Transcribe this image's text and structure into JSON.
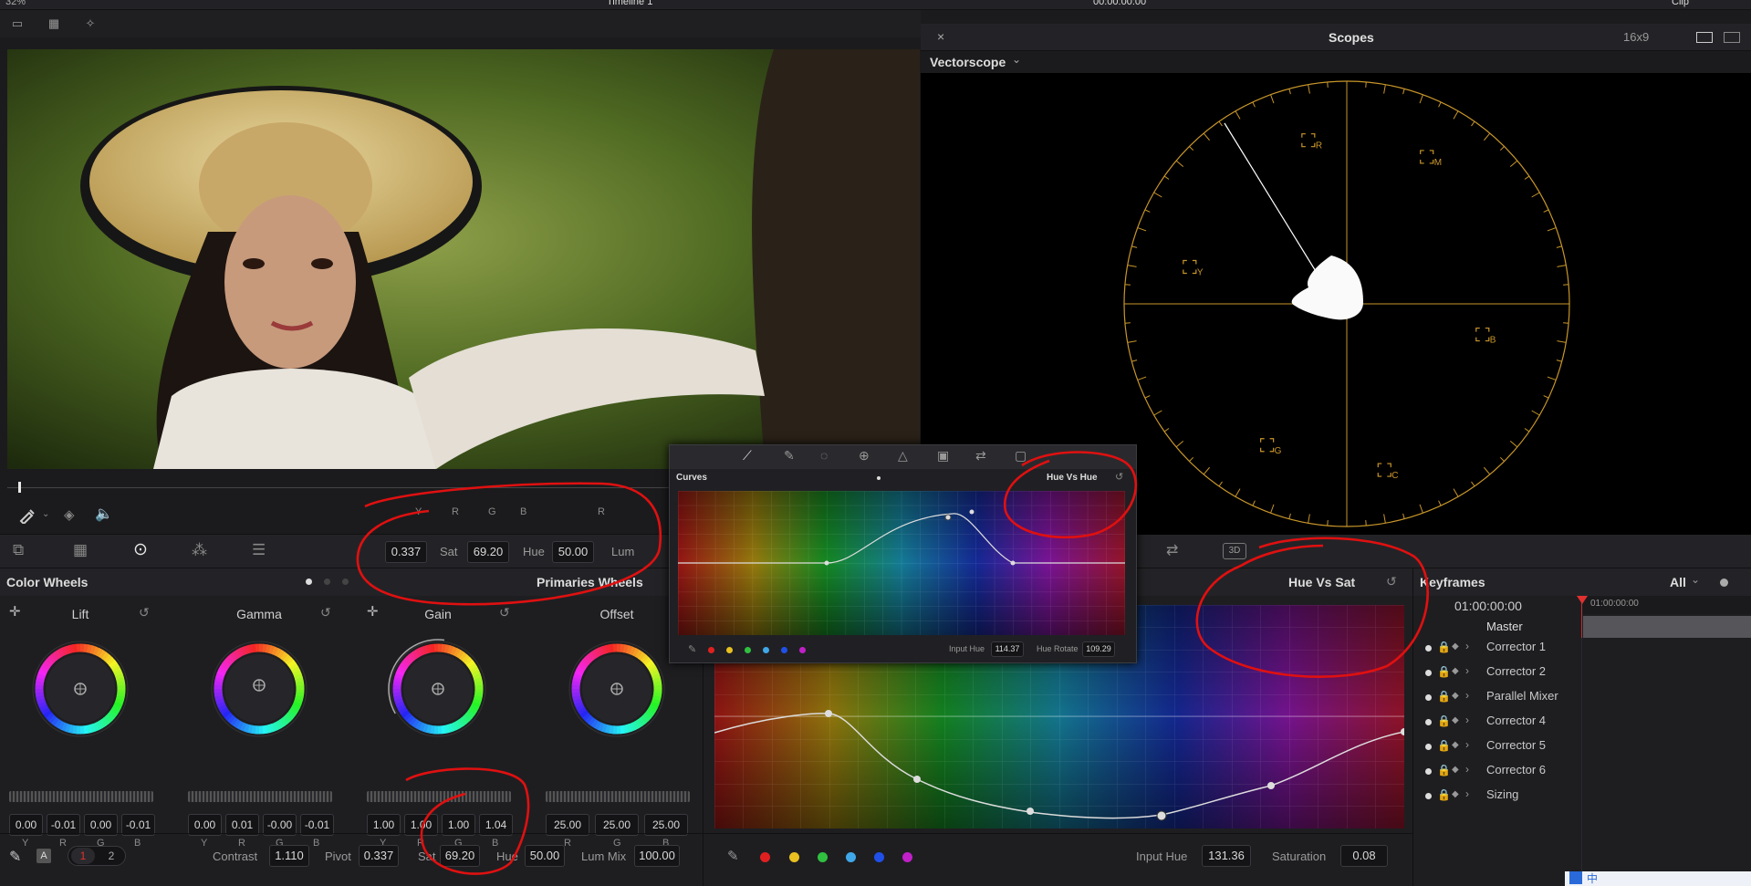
{
  "topbar": {
    "zoom": "32%",
    "timeline_name": "Timeline 1",
    "timecode": "00:00:00:00",
    "mode": "Clip"
  },
  "viewer": {
    "image_description_icon": "photo"
  },
  "scopes": {
    "title": "Scopes",
    "aspect": "16x9",
    "scope_type": "Vectorscope",
    "targets": [
      "R",
      "M",
      "Y",
      "B",
      "G",
      "C"
    ],
    "graticule_color": "#c8962a"
  },
  "viewer_controls": {
    "header_labels": [
      "Y",
      "R",
      "G",
      "B",
      "R"
    ],
    "pivot_value": "0.337",
    "sat_label": "Sat",
    "sat_value": "69.20",
    "hue_label": "Hue",
    "hue_value": "50.00",
    "lum_label": "Lum"
  },
  "color_wheels": {
    "title": "Color Wheels",
    "mode": "Primaries Wheels",
    "wheels": [
      {
        "name": "Lift",
        "values": [
          "0.00",
          "-0.01",
          "0.00",
          "-0.01"
        ],
        "channels": [
          "Y",
          "R",
          "G",
          "B"
        ]
      },
      {
        "name": "Gamma",
        "values": [
          "0.00",
          "0.01",
          "-0.00",
          "-0.01"
        ],
        "channels": [
          "Y",
          "R",
          "G",
          "B"
        ]
      },
      {
        "name": "Gain",
        "values": [
          "1.00",
          "1.00",
          "1.00",
          "1.04"
        ],
        "channels": [
          "Y",
          "R",
          "G",
          "B"
        ]
      },
      {
        "name": "Offset",
        "values": [
          "25.00",
          "25.00",
          "25.00"
        ],
        "channels": [
          "R",
          "G",
          "B"
        ]
      }
    ],
    "footer": {
      "auto_label": "A",
      "page1": "1",
      "page2": "2",
      "contrast_label": "Contrast",
      "contrast_value": "1.110",
      "pivot_label": "Pivot",
      "pivot_value": "0.337",
      "sat_label": "Sat",
      "sat_value": "69.20",
      "hue_label": "Hue",
      "hue_value": "50.00",
      "lummix_label": "Lum Mix",
      "lummix_value": "100.00"
    }
  },
  "curves_panel": {
    "mode": "Hue Vs Sat",
    "input_hue_label": "Input Hue",
    "input_hue_value": "131.36",
    "saturation_label": "Saturation",
    "saturation_value": "0.08",
    "swatch_colors": [
      "#e02020",
      "#e8c020",
      "#30c040",
      "#40a8e8",
      "#2050e8",
      "#c020c8"
    ]
  },
  "curves_popup": {
    "title": "Curves",
    "mode": "Hue Vs Hue",
    "input_hue_label": "Input Hue",
    "input_hue_value": "114.37",
    "hue_rotate_label": "Hue Rotate",
    "hue_rotate_value": "109.29"
  },
  "keyframes": {
    "title": "Keyframes",
    "filter": "All",
    "timecode": "01:00:00:00",
    "ruler_time": "01:00:00:00",
    "master": "Master",
    "tracks": [
      "Corrector 1",
      "Corrector 2",
      "Parallel Mixer",
      "Corrector 4",
      "Corrector 5",
      "Corrector 6",
      "Sizing"
    ]
  },
  "tools": {
    "3d_label": "3D"
  },
  "taskbar": {
    "ime": "中"
  }
}
